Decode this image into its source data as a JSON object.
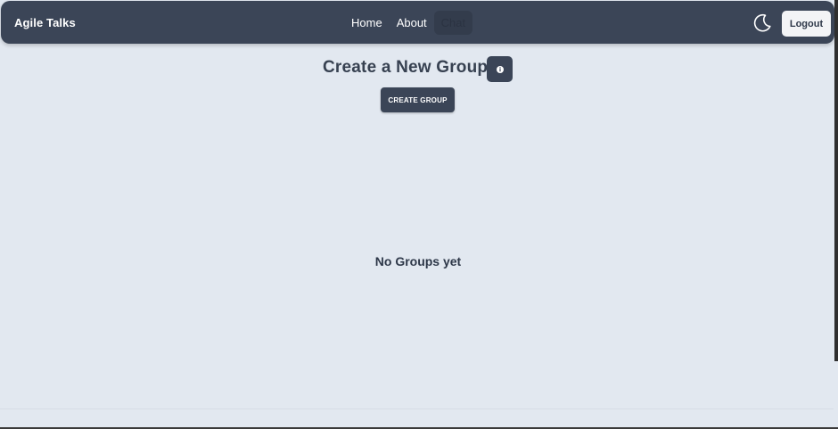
{
  "navbar": {
    "brand": "Agile Talks",
    "links": [
      {
        "label": "Home"
      },
      {
        "label": "About"
      },
      {
        "label": "Chat"
      }
    ],
    "theme_toggle_icon": "moon-icon",
    "logout_label": "Logout"
  },
  "main": {
    "title": "Create a New Group",
    "info_icon": "info-icon",
    "create_button_label": "CREATE GROUP",
    "empty_message": "No Groups yet"
  },
  "colors": {
    "navbar_bg": "#3b4557",
    "page_bg": "#e2e8f0",
    "text_dark": "#374151",
    "button_bg": "#3b4557"
  }
}
